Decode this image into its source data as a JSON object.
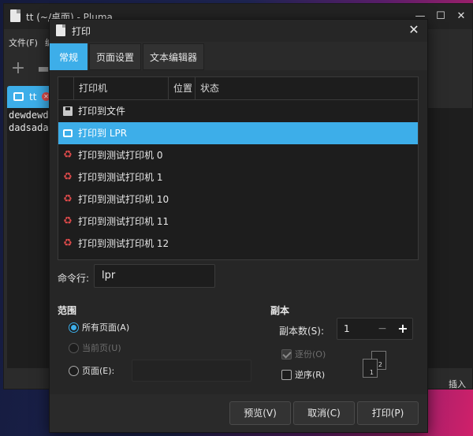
{
  "background_window": {
    "title": "tt (~/桌面) - Pluma",
    "menu": [
      "文件(F)",
      "编"
    ],
    "tab_label": "tt",
    "editor_lines": [
      "dewdewdewd",
      "dadsadasdsa"
    ],
    "status_mode": "插入"
  },
  "dialog": {
    "title": "打印",
    "tabs": [
      {
        "label": "常规",
        "active": true
      },
      {
        "label": "页面设置",
        "active": false
      },
      {
        "label": "文本编辑器",
        "active": false
      }
    ],
    "printer_table": {
      "headers": [
        "打印机",
        "位置",
        "状态"
      ],
      "rows": [
        {
          "name": "打印到文件",
          "icon": "file-icon",
          "selected": false
        },
        {
          "name": "打印到 LPR",
          "icon": "printer-icon",
          "selected": true
        },
        {
          "name": "打印到测试打印机 0",
          "icon": "recycle-icon",
          "selected": false
        },
        {
          "name": "打印到测试打印机 1",
          "icon": "recycle-icon",
          "selected": false
        },
        {
          "name": "打印到测试打印机 10",
          "icon": "recycle-icon",
          "selected": false
        },
        {
          "name": "打印到测试打印机 11",
          "icon": "recycle-icon",
          "selected": false
        },
        {
          "name": "打印到测试打印机 12",
          "icon": "recycle-icon",
          "selected": false
        }
      ]
    },
    "command_line": {
      "label": "命令行:",
      "value": "lpr"
    },
    "range": {
      "title": "范围",
      "all_pages": "所有页面(A)",
      "current_page": "当前页(U)",
      "pages": "页面(E):"
    },
    "copies": {
      "title": "副本",
      "label": "副本数(S):",
      "value": "1",
      "minus": "−",
      "plus": "+",
      "collate": "逐份(O)",
      "reverse": "逆序(R)"
    },
    "buttons": {
      "preview": "预览(V)",
      "cancel": "取消(C)",
      "print": "打印(P)"
    },
    "accent_color": "#3daee9"
  }
}
